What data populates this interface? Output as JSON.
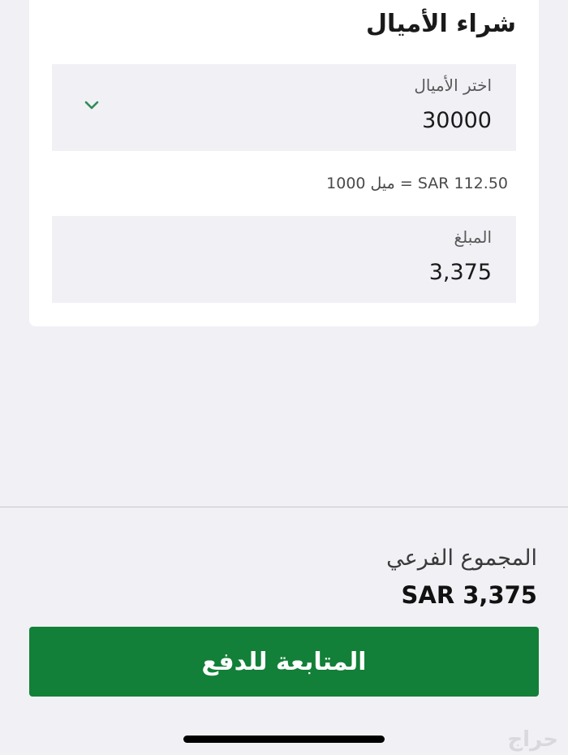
{
  "card": {
    "title": "شراء الأميال",
    "miles_field": {
      "label": "اختر الأميال",
      "value": "30000",
      "icon": "chevron-down-icon"
    },
    "rate_text": "1000 ميل = SAR 112.50",
    "amount_field": {
      "label": "المبلغ",
      "value": "3,375"
    }
  },
  "summary": {
    "subtotal_label": "المجموع الفرعي",
    "subtotal_value": "SAR 3,375"
  },
  "actions": {
    "continue_label": "المتابعة للدفع"
  },
  "watermark": "حراج",
  "colors": {
    "accent_green": "#128038",
    "chevron_green": "#2e8b57",
    "background": "#f1f0f5"
  }
}
